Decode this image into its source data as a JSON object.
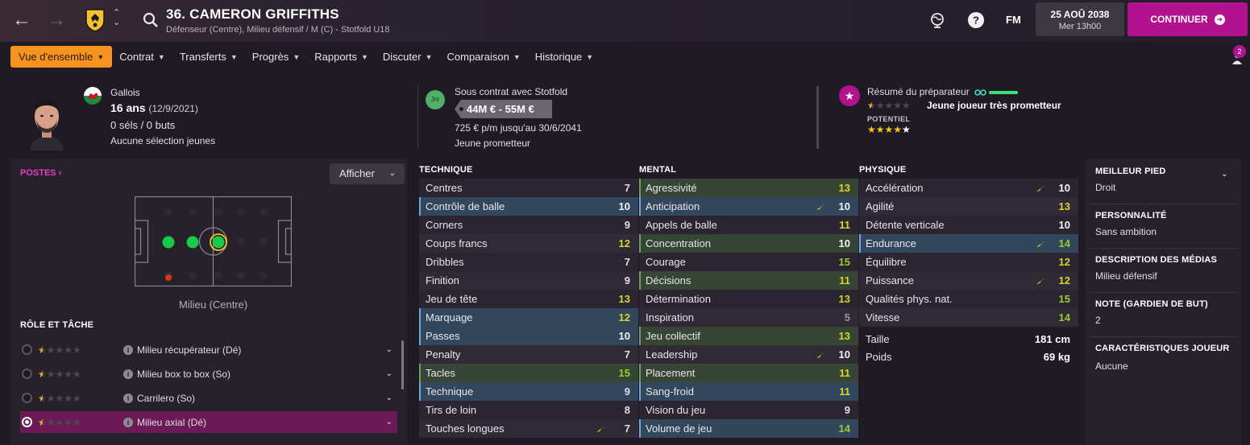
{
  "header": {
    "back": "←",
    "forward": "→",
    "title": "36. CAMERON GRIFFITHS",
    "subtitle": "Défenseur (Centre), Milieu défensif / M (C) - Stotfold U18",
    "fm": "FM",
    "date": "25 AOÛ 2038",
    "time": "Mer 13h00",
    "continue": "CONTINUER",
    "notif_count": "2"
  },
  "tabs": [
    {
      "label": "Vue d'ensemble"
    },
    {
      "label": "Contrat"
    },
    {
      "label": "Transferts"
    },
    {
      "label": "Progrès"
    },
    {
      "label": "Rapports"
    },
    {
      "label": "Discuter"
    },
    {
      "label": "Comparaison"
    },
    {
      "label": "Historique"
    }
  ],
  "profile": {
    "nationality": "Gallois",
    "age": "16 ans",
    "dob": "(12/9/2021)",
    "caps": "0 séls / 0 buts",
    "youth_caps": "Aucune sélection jeunes",
    "jnr": "Jnr",
    "contract": "Sous contrat avec Stotfold",
    "value": "44M € - 55M €",
    "wage": "725 € p/m jusqu'au 30/6/2041",
    "prospect": "Jeune prometteur",
    "coach_title": "Résumé du préparateur",
    "coach_summary": "Jeune joueur très prometteur",
    "potential_label": "POTENTIEL",
    "current_stars": 1.5,
    "potential_stars": 4.5
  },
  "positions": {
    "title": "POSTES",
    "show": "Afficher",
    "pitch_label": "Milieu (Centre)"
  },
  "roles": {
    "title": "RÔLE ET TÂCHE",
    "items": [
      {
        "label": "Milieu récupérateur (Dé)",
        "stars": 1.5
      },
      {
        "label": "Milieu box to box (So)",
        "stars": 1.5
      },
      {
        "label": "Carrilero (So)",
        "stars": 1.5
      },
      {
        "label": "Milieu axial (Dé)",
        "stars": 1.5
      }
    ]
  },
  "technique": {
    "title": "TECHNIQUE",
    "rows": [
      {
        "name": "Centres",
        "value": "7"
      },
      {
        "name": "Contrôle de balle",
        "value": "10"
      },
      {
        "name": "Corners",
        "value": "9"
      },
      {
        "name": "Coups francs",
        "value": "12"
      },
      {
        "name": "Dribbles",
        "value": "7"
      },
      {
        "name": "Finition",
        "value": "9"
      },
      {
        "name": "Jeu de tête",
        "value": "13"
      },
      {
        "name": "Marquage",
        "value": "12"
      },
      {
        "name": "Passes",
        "value": "10"
      },
      {
        "name": "Penalty",
        "value": "7"
      },
      {
        "name": "Tacles",
        "value": "15"
      },
      {
        "name": "Technique",
        "value": "9"
      },
      {
        "name": "Tirs de loin",
        "value": "8"
      },
      {
        "name": "Touches longues",
        "value": "7"
      }
    ]
  },
  "mental": {
    "title": "MENTAL",
    "rows": [
      {
        "name": "Agressivité",
        "value": "13"
      },
      {
        "name": "Anticipation",
        "value": "10"
      },
      {
        "name": "Appels de balle",
        "value": "11"
      },
      {
        "name": "Concentration",
        "value": "10"
      },
      {
        "name": "Courage",
        "value": "15"
      },
      {
        "name": "Décisions",
        "value": "11"
      },
      {
        "name": "Détermination",
        "value": "13"
      },
      {
        "name": "Inspiration",
        "value": "5"
      },
      {
        "name": "Jeu collectif",
        "value": "13"
      },
      {
        "name": "Leadership",
        "value": "10"
      },
      {
        "name": "Placement",
        "value": "11"
      },
      {
        "name": "Sang-froid",
        "value": "11"
      },
      {
        "name": "Vision du jeu",
        "value": "9"
      },
      {
        "name": "Volume de jeu",
        "value": "14"
      }
    ]
  },
  "physique": {
    "title": "PHYSIQUE",
    "rows": [
      {
        "name": "Accélération",
        "value": "10"
      },
      {
        "name": "Agilité",
        "value": "13"
      },
      {
        "name": "Détente verticale",
        "value": "10"
      },
      {
        "name": "Endurance",
        "value": "14"
      },
      {
        "name": "Équilibre",
        "value": "12"
      },
      {
        "name": "Puissance",
        "value": "12"
      },
      {
        "name": "Qualités phys. nat.",
        "value": "15"
      },
      {
        "name": "Vitesse",
        "value": "14"
      }
    ],
    "height_label": "Taille",
    "height": "181 cm",
    "weight_label": "Poids",
    "weight": "69 kg"
  },
  "info": {
    "foot_label": "MEILLEUR PIED",
    "foot": "Droit",
    "personality_label": "PERSONNALITÉ",
    "personality": "Sans ambition",
    "media_label": "DESCRIPTION DES MÉDIAS",
    "media": "Milieu défensif",
    "gk_label": "NOTE (GARDIEN DE BUT)",
    "gk": "2",
    "traits_label": "CARACTÉRISTIQUES JOUEUR",
    "traits": "Aucune"
  },
  "colors": {
    "accent": "#b3128f",
    "tab_active": "#f7931e",
    "position_natural": "#19c94a",
    "trend": "#d9d42a"
  }
}
